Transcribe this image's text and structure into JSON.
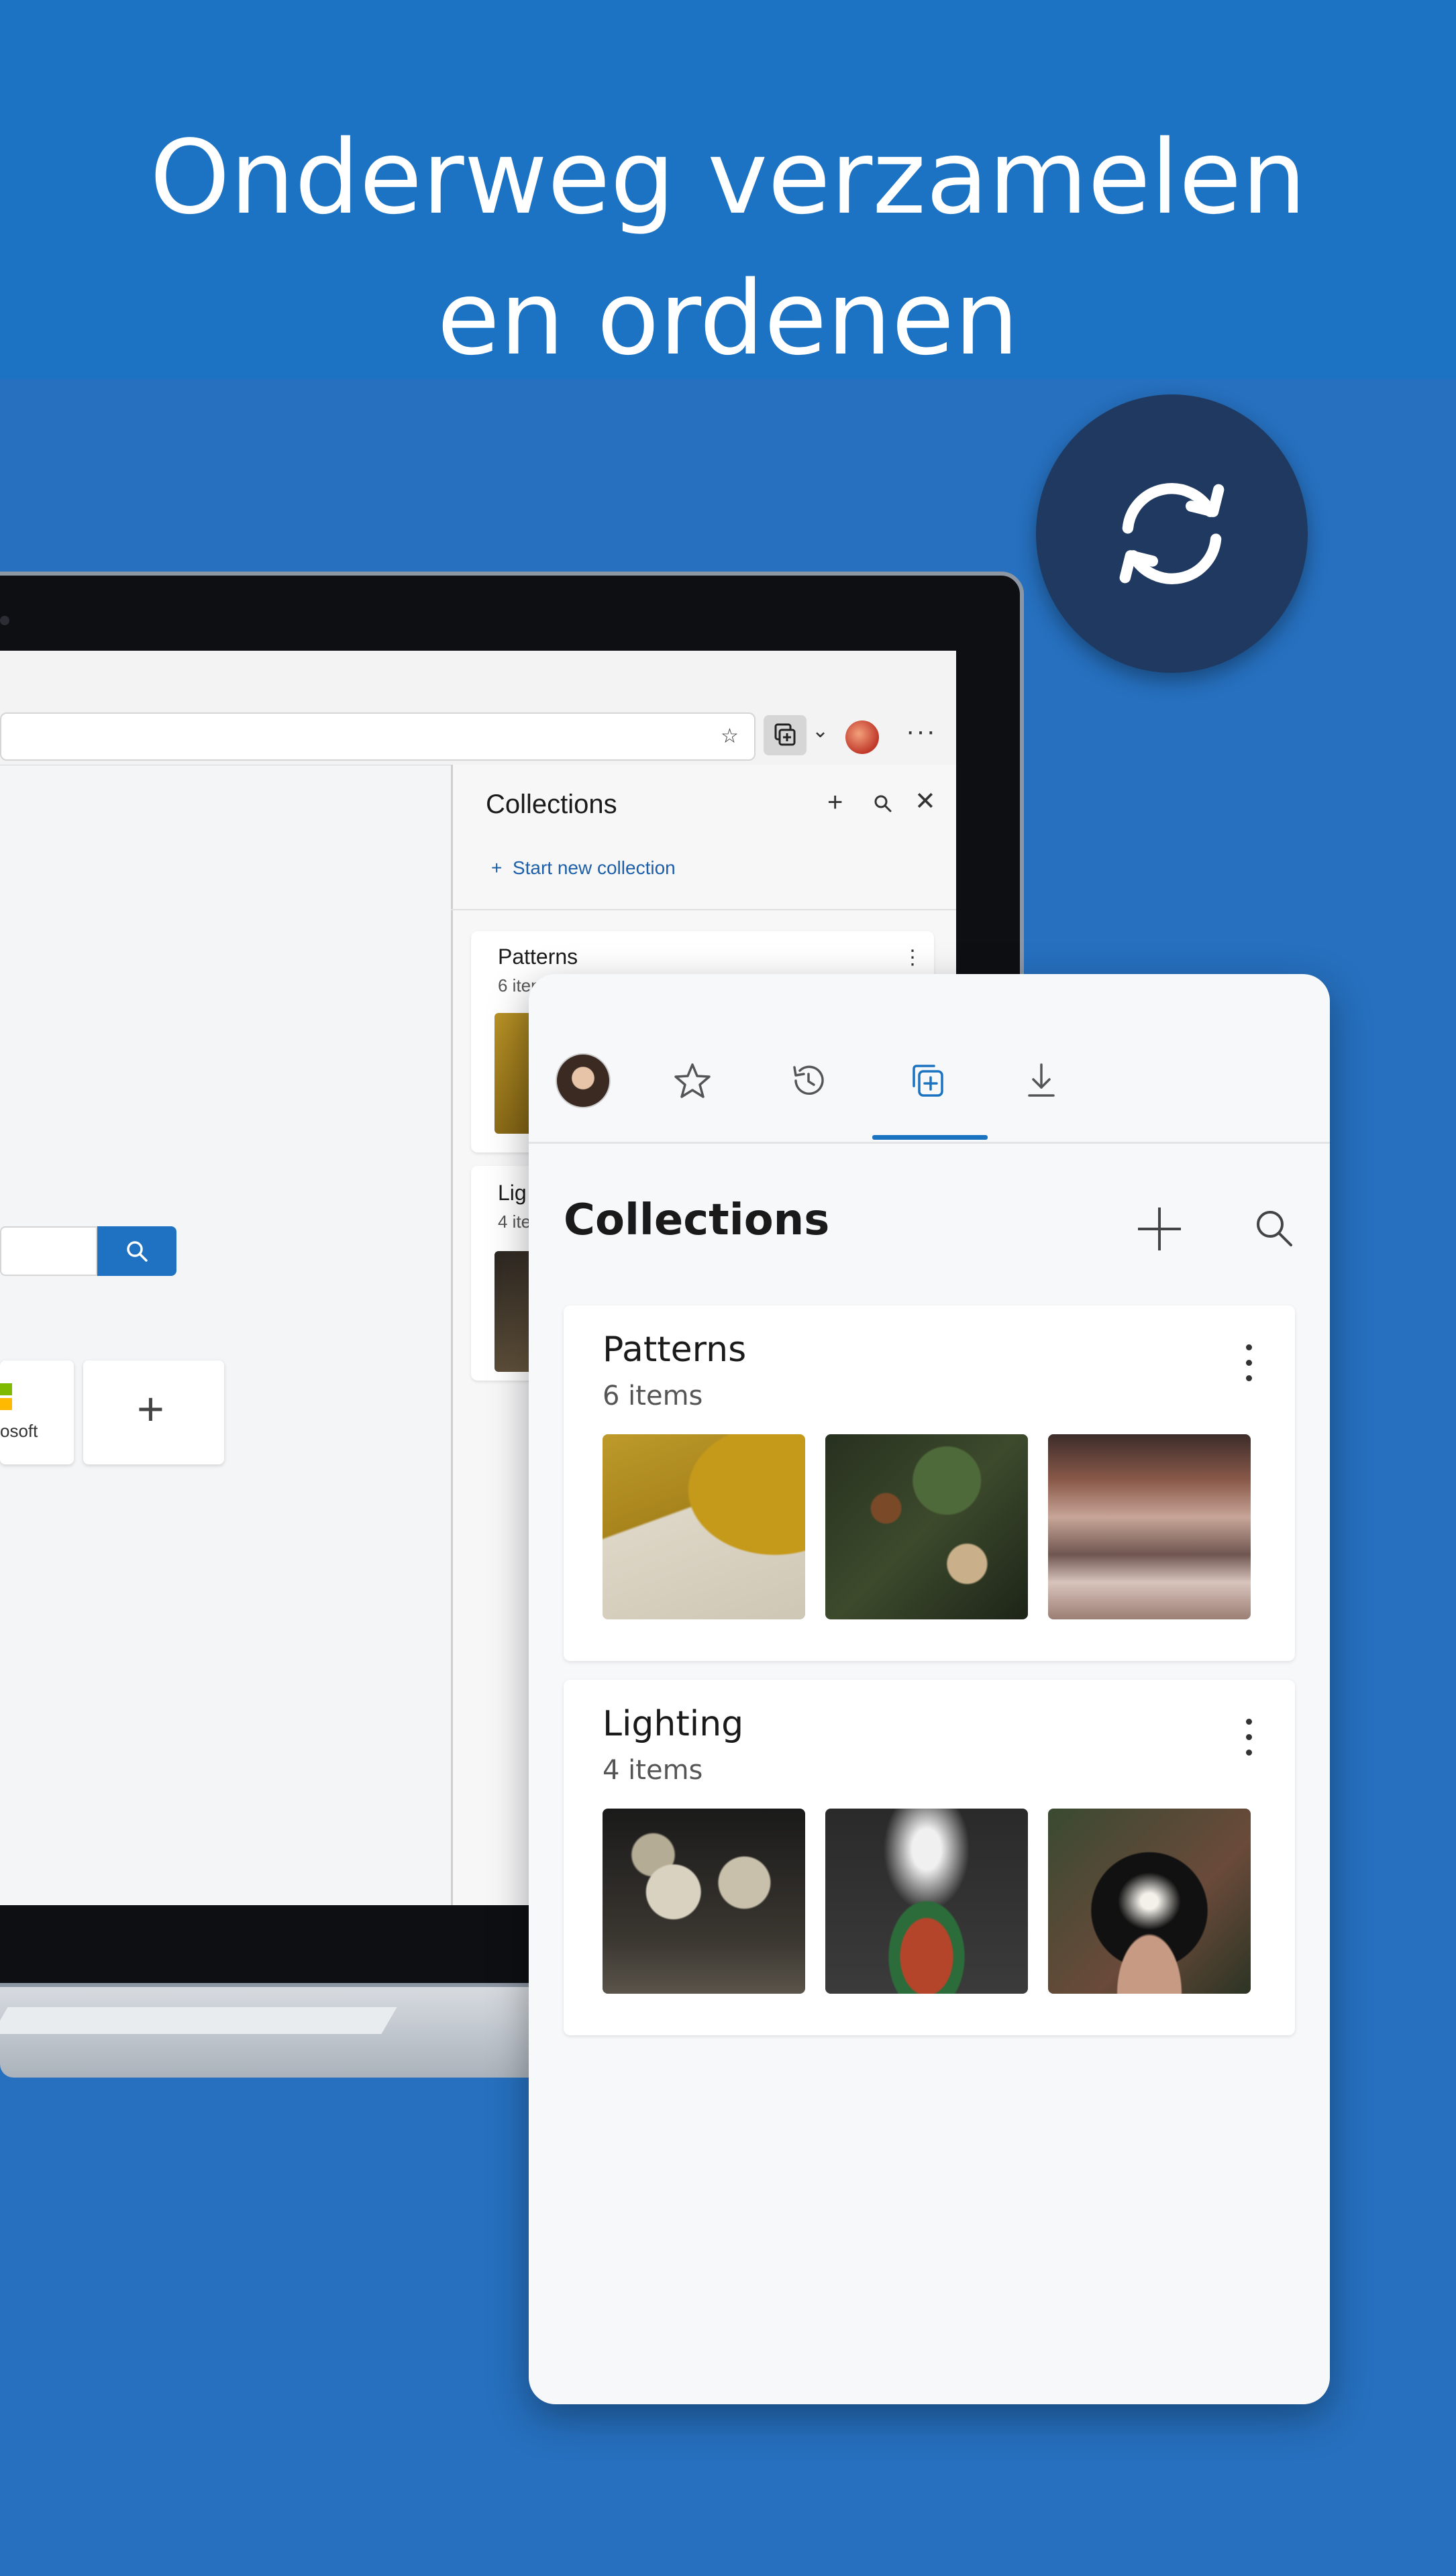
{
  "headline": {
    "line1": "Onderweg verzamelen",
    "line2": "en ordenen"
  },
  "sync_badge": {
    "icon": "sync-icon",
    "color": "#1f3960"
  },
  "browser": {
    "toolbar": {
      "favorites_icon": "favorite-star-icon",
      "collections_icon": "collections-icon",
      "more_label": "···"
    },
    "page": {
      "tile_label": "osoft",
      "add_tile_label": "+"
    },
    "side_pane": {
      "title": "Collections",
      "add_label": "+",
      "close_label": "✕",
      "start_new": "Start new collection",
      "collections": [
        {
          "title": "Patterns",
          "count": "6 iten",
          "more": "⋮"
        },
        {
          "title": "Lig",
          "count": "4 ite"
        }
      ]
    }
  },
  "app": {
    "tabs": [
      {
        "name": "profile",
        "icon": "avatar"
      },
      {
        "name": "favorites",
        "icon": "star-icon"
      },
      {
        "name": "history",
        "icon": "history-icon"
      },
      {
        "name": "collections",
        "icon": "collections-icon",
        "active": true
      },
      {
        "name": "downloads",
        "icon": "download-icon"
      }
    ],
    "title": "Collections",
    "collections": [
      {
        "title": "Patterns",
        "count": "6 items"
      },
      {
        "title": "Lighting",
        "count": "4 items"
      }
    ],
    "accent": "#1a73c0"
  }
}
